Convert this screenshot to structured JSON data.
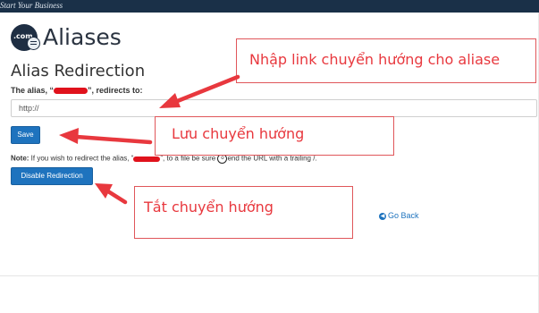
{
  "header": {
    "tagline": "Start Your Business"
  },
  "page": {
    "title": "Aliases",
    "section_title": "Alias Redirection",
    "alias_label_prefix": "The alias, “",
    "alias_label_suffix": "”, redirects to:",
    "url_input_value": "http://",
    "save_label": "Save",
    "note_bold": "Note:",
    "note_part1": " If you wish to redirect the alias, “",
    "note_part2": "”, to a file be sure",
    "note_part3": "end the URL with a trailing /.",
    "note_circle": "o",
    "disable_label": "Disable Redirection",
    "go_back_label": "Go Back"
  },
  "annotations": {
    "input_hint": "Nhập link chuyển hướng cho aliase",
    "save_hint": "Lưu chuyển hướng",
    "disable_hint": "Tắt chuyển hướng"
  },
  "colors": {
    "accent": "#1e73be",
    "annotation_red": "#e8383e",
    "redaction": "#e0121c",
    "topbar": "#1a3048"
  }
}
